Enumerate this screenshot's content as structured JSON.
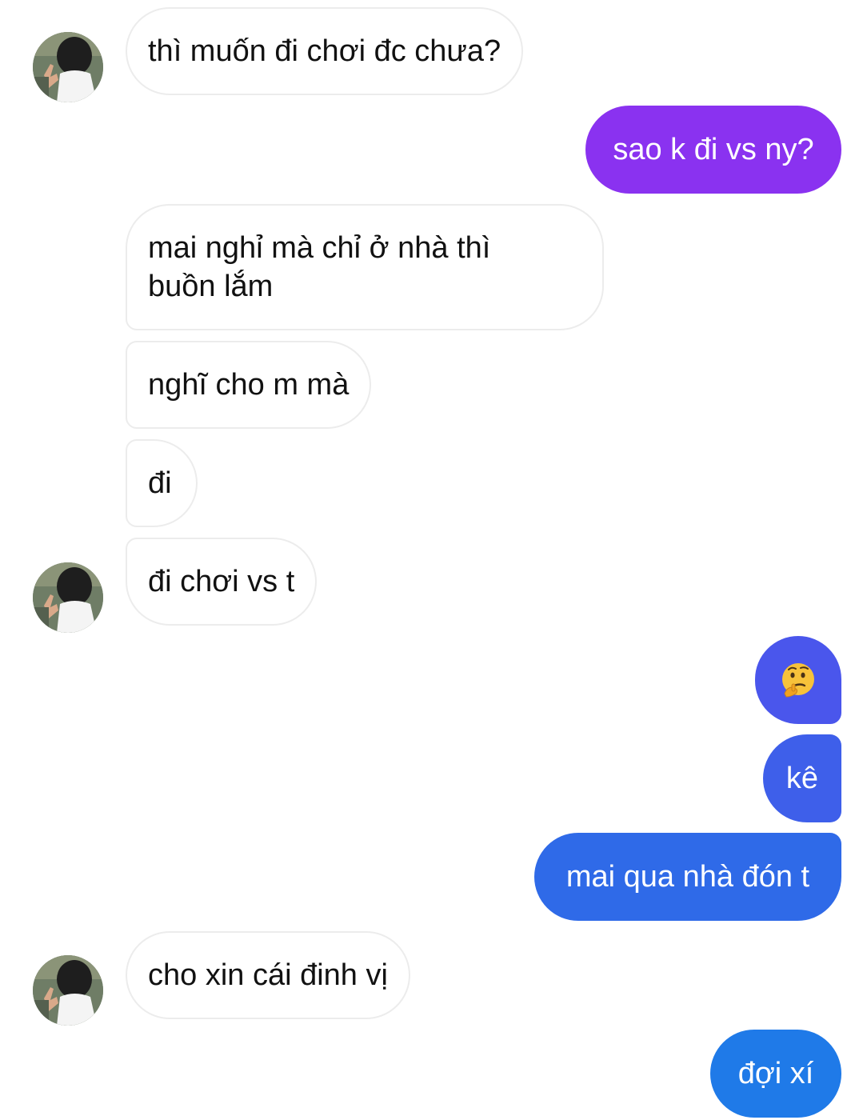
{
  "colors": {
    "incoming_bg": "#ffffff",
    "incoming_border": "#ececec",
    "outgoing_purple": "#8a32f0",
    "outgoing_indigo": "#4a56ec",
    "outgoing_blue": "#2f6ae8",
    "outgoing_light_blue": "#1f7ae8"
  },
  "messages": [
    {
      "id": "m1",
      "direction": "incoming",
      "text": "thì muốn đi chơi đc chưa?",
      "has_avatar": true
    },
    {
      "id": "m2",
      "direction": "outgoing",
      "text": "sao k đi vs ny?"
    },
    {
      "id": "m3",
      "direction": "incoming",
      "text_line1": "mai nghỉ mà chỉ ở nhà thì",
      "text_line2": "buồn lắm",
      "has_avatar": false
    },
    {
      "id": "m4",
      "direction": "incoming",
      "text": "nghĩ cho m mà",
      "has_avatar": false
    },
    {
      "id": "m5",
      "direction": "incoming",
      "text": "đi",
      "has_avatar": false
    },
    {
      "id": "m6",
      "direction": "incoming",
      "text": "đi chơi vs t",
      "has_avatar": true
    },
    {
      "id": "m7",
      "direction": "outgoing",
      "emoji": "thinking-face"
    },
    {
      "id": "m8",
      "direction": "outgoing",
      "text": "kê"
    },
    {
      "id": "m9",
      "direction": "outgoing",
      "text": "mai qua nhà đón t"
    },
    {
      "id": "m10",
      "direction": "incoming",
      "text": "cho xin cái đinh vị",
      "has_avatar": true
    },
    {
      "id": "m11",
      "direction": "outgoing",
      "text": "đợi xí"
    }
  ]
}
